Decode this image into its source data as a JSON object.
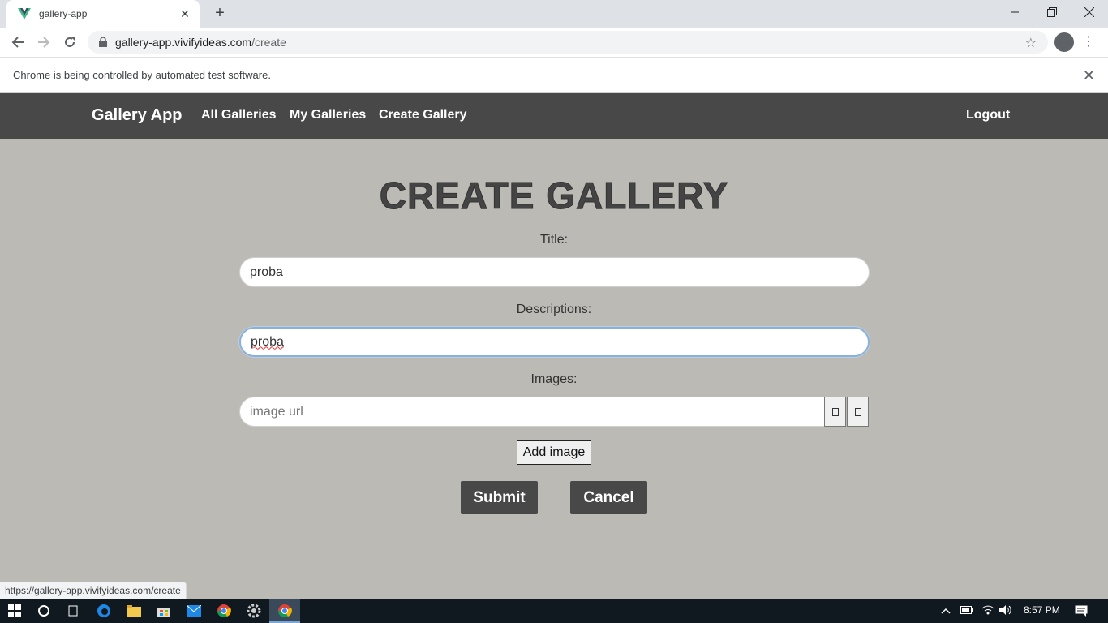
{
  "browser": {
    "tab_title": "gallery-app",
    "tab_close": "✕",
    "new_tab": "+",
    "url_host": "gallery-app.vivifyideas.com",
    "url_path": "/create",
    "infobar_text": "Chrome is being controlled by automated test software.",
    "status_url": "https://gallery-app.vivifyideas.com/create"
  },
  "app": {
    "brand": "Gallery App",
    "nav": {
      "all_galleries": "All Galleries",
      "my_galleries": "My Galleries",
      "create_gallery": "Create Gallery",
      "logout": "Logout"
    },
    "form": {
      "heading": "CREATE GALLERY",
      "title_label": "Title:",
      "title_value": "proba",
      "description_label": "Descriptions:",
      "description_value": "proba",
      "images_label": "Images:",
      "image_placeholder": "image url",
      "add_image": "Add image",
      "submit": "Submit",
      "cancel": "Cancel"
    }
  },
  "taskbar": {
    "time": "8:57 PM"
  },
  "colors": {
    "page_bg": "#bcbab4",
    "navbar_bg": "#484848",
    "button_bg": "#484848",
    "focus_border": "#8db0d6"
  }
}
